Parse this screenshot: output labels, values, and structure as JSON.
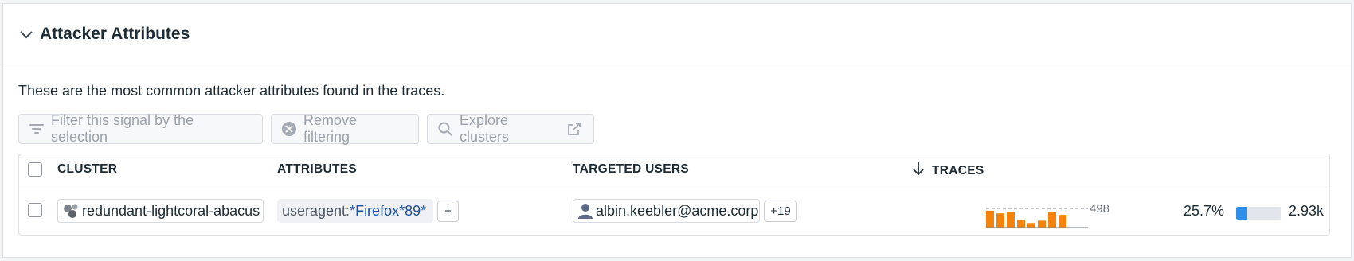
{
  "panel": {
    "title": "Attacker Attributes",
    "description": "These are the most common attacker attributes found in the traces."
  },
  "buttons": {
    "filter_label": "Filter this signal by the selection",
    "remove_label": "Remove filtering",
    "explore_label": "Explore clusters"
  },
  "table": {
    "headers": {
      "cluster": "CLUSTER",
      "attributes": "ATTRIBUTES",
      "targeted_users": "TARGETED USERS",
      "traces": "TRACES"
    },
    "sort": {
      "column": "traces",
      "direction": "descending",
      "icon": "arrow-down-icon"
    },
    "rows": [
      {
        "cluster": "redundant-lightcoral-abacus",
        "attribute_key": "useragent:",
        "attribute_value": "*Firefox*89*",
        "attribute_more": "+",
        "user": "albin.keebler@acme.corp",
        "users_more": "+19",
        "spark_max": "498",
        "spark_values": [
          0.88,
          0.74,
          0.82,
          0.42,
          0.24,
          0.36,
          0.82,
          0.66
        ],
        "traces_pct": "25.7%",
        "traces_fraction": 0.257,
        "traces_count": "2.93k"
      }
    ]
  },
  "colors": {
    "spark_bar": "#f5820d",
    "traces_bar": "#2f8fe8",
    "attr_value": "#1a4fa0"
  }
}
